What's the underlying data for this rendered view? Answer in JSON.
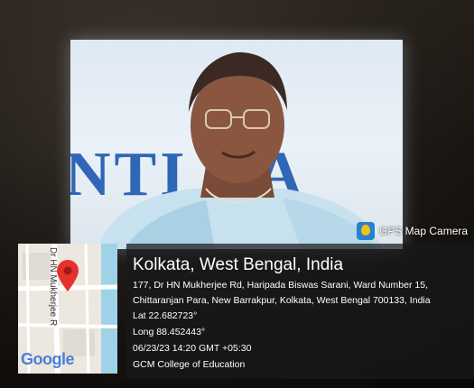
{
  "background_text": "NTI CA",
  "map": {
    "street_label": "Dr HN Mukherjee R",
    "logo": "Google"
  },
  "app_badge": {
    "icon": "map-pin-icon",
    "name": "GPS Map Camera"
  },
  "location": {
    "title": "Kolkata, West Bengal, India",
    "address_line1": "177, Dr HN Mukherjee Rd, Haripada Biswas Sarani, Ward Number 15,",
    "address_line2": "Chittaranjan Para, New Barrakpur, Kolkata, West Bengal 700133, India",
    "lat": "Lat 22.682723°",
    "long": "Long 88.452443°",
    "datetime": "06/23/23 14:20 GMT +05:30",
    "note": "GCM College of Education"
  },
  "colors": {
    "overlay": "#19191c",
    "pin": "#e5322d",
    "screen_text": "#2f66b5"
  }
}
